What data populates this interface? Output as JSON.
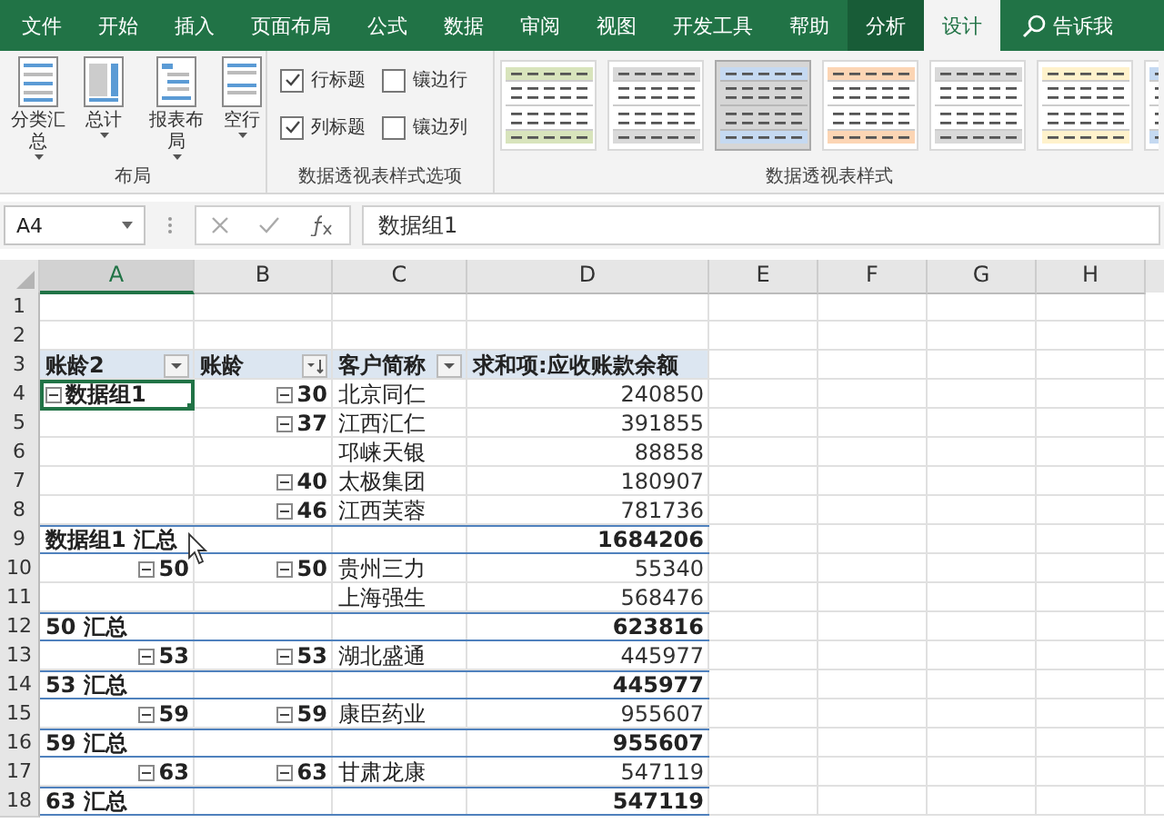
{
  "tabs": [
    {
      "label": "文件",
      "kind": "normal",
      "selected": false
    },
    {
      "label": "开始",
      "kind": "normal",
      "selected": false
    },
    {
      "label": "插入",
      "kind": "normal",
      "selected": false
    },
    {
      "label": "页面布局",
      "kind": "normal",
      "selected": false
    },
    {
      "label": "公式",
      "kind": "normal",
      "selected": false
    },
    {
      "label": "数据",
      "kind": "normal",
      "selected": false
    },
    {
      "label": "审阅",
      "kind": "normal",
      "selected": false
    },
    {
      "label": "视图",
      "kind": "normal",
      "selected": false
    },
    {
      "label": "开发工具",
      "kind": "normal",
      "selected": false
    },
    {
      "label": "帮助",
      "kind": "normal",
      "selected": false
    },
    {
      "label": "分析",
      "kind": "context",
      "selected": false
    },
    {
      "label": "设计",
      "kind": "context",
      "selected": true
    },
    {
      "label": "告诉我",
      "kind": "search",
      "selected": false
    }
  ],
  "ribbon": {
    "layout_group": {
      "label": "布局",
      "buttons": [
        {
          "label": "分类汇总"
        },
        {
          "label": "总计"
        },
        {
          "label": "报表布局"
        },
        {
          "label": "空行"
        }
      ]
    },
    "options_group": {
      "label": "数据透视表样式选项",
      "options": [
        {
          "label": "行标题",
          "checked": true
        },
        {
          "label": "镶边行",
          "checked": false
        },
        {
          "label": "列标题",
          "checked": true
        },
        {
          "label": "镶边列",
          "checked": false
        }
      ]
    },
    "styles_group": {
      "label": "数据透视表样式",
      "styles": [
        {
          "color": "#d8e4bc",
          "selected": false
        },
        {
          "color": "#d9d9d9",
          "selected": false
        },
        {
          "color": "#c5d9f1",
          "selected": true
        },
        {
          "color": "#fcd5b4",
          "selected": false
        },
        {
          "color": "#d9d9d9",
          "selected": false
        },
        {
          "color": "#fff2cc",
          "selected": false
        },
        {
          "color": "#c5d9f1",
          "selected": false
        }
      ]
    }
  },
  "formula_bar": {
    "name_box": "A4",
    "value": "数据组1"
  },
  "columns": [
    {
      "label": "A",
      "selected": true
    },
    {
      "label": "B",
      "selected": false
    },
    {
      "label": "C",
      "selected": false
    },
    {
      "label": "D",
      "selected": false
    },
    {
      "label": "E",
      "selected": false
    },
    {
      "label": "F",
      "selected": false
    },
    {
      "label": "G",
      "selected": false
    },
    {
      "label": "H",
      "selected": false
    }
  ],
  "rows": [
    {
      "num": "1",
      "kind": "blank"
    },
    {
      "num": "2",
      "kind": "blank"
    },
    {
      "num": "3",
      "kind": "header",
      "a": {
        "text": "账龄2",
        "filter": true,
        "sorted": false,
        "selected": false
      },
      "b": {
        "text": "账龄",
        "filter": true,
        "sorted": true
      },
      "c": {
        "text": "客户简称",
        "filter": true,
        "sorted": false
      },
      "d": {
        "text": "求和项:应收账款余额"
      }
    },
    {
      "num": "4",
      "kind": "item",
      "a": {
        "text": "数据组1",
        "kind": "label",
        "expander": true,
        "selected": true
      },
      "b": {
        "text": "30",
        "expander": true
      },
      "c": {
        "text": "北京同仁"
      },
      "d": {
        "text": "240850"
      }
    },
    {
      "num": "5",
      "kind": "item",
      "a": {
        "selected": false
      },
      "b": {
        "text": "37",
        "expander": true
      },
      "c": {
        "text": "江西汇仁"
      },
      "d": {
        "text": "391855"
      }
    },
    {
      "num": "6",
      "kind": "item",
      "a": {
        "selected": false
      },
      "c": {
        "text": "邛崃天银"
      },
      "d": {
        "text": "88858"
      }
    },
    {
      "num": "7",
      "kind": "item",
      "a": {
        "selected": false
      },
      "b": {
        "text": "40",
        "expander": true
      },
      "c": {
        "text": "太极集团"
      },
      "d": {
        "text": "180907"
      }
    },
    {
      "num": "8",
      "kind": "item",
      "a": {
        "selected": false
      },
      "b": {
        "text": "46",
        "expander": true
      },
      "c": {
        "text": "江西芙蓉"
      },
      "d": {
        "text": "781736"
      }
    },
    {
      "num": "9",
      "kind": "subtotal",
      "a": {
        "text": "数据组1 汇总",
        "kind": "label",
        "selected": false
      },
      "d": {
        "text": "1684206"
      }
    },
    {
      "num": "10",
      "kind": "item",
      "a": {
        "text": "50",
        "kind": "number",
        "expander": true,
        "selected": false
      },
      "b": {
        "text": "50",
        "expander": true
      },
      "c": {
        "text": "贵州三力"
      },
      "d": {
        "text": "55340"
      }
    },
    {
      "num": "11",
      "kind": "item",
      "a": {
        "selected": false
      },
      "c": {
        "text": "上海强生"
      },
      "d": {
        "text": "568476"
      }
    },
    {
      "num": "12",
      "kind": "subtotal",
      "a": {
        "text": "50 汇总",
        "kind": "label",
        "selected": false
      },
      "d": {
        "text": "623816"
      }
    },
    {
      "num": "13",
      "kind": "item",
      "a": {
        "text": "53",
        "kind": "number",
        "expander": true,
        "selected": false
      },
      "b": {
        "text": "53",
        "expander": true
      },
      "c": {
        "text": "湖北盛通"
      },
      "d": {
        "text": "445977"
      }
    },
    {
      "num": "14",
      "kind": "subtotal",
      "a": {
        "text": "53 汇总",
        "kind": "label",
        "selected": false
      },
      "d": {
        "text": "445977"
      }
    },
    {
      "num": "15",
      "kind": "item",
      "a": {
        "text": "59",
        "kind": "number",
        "expander": true,
        "selected": false
      },
      "b": {
        "text": "59",
        "expander": true
      },
      "c": {
        "text": "康臣药业"
      },
      "d": {
        "text": "955607"
      }
    },
    {
      "num": "16",
      "kind": "subtotal",
      "a": {
        "text": "59 汇总",
        "kind": "label",
        "selected": false
      },
      "d": {
        "text": "955607"
      }
    },
    {
      "num": "17",
      "kind": "item",
      "a": {
        "text": "63",
        "kind": "number",
        "expander": true,
        "selected": false
      },
      "b": {
        "text": "63",
        "expander": true
      },
      "c": {
        "text": "甘肃龙康"
      },
      "d": {
        "text": "547119"
      }
    },
    {
      "num": "18",
      "kind": "subtotal",
      "a": {
        "text": "63 汇总",
        "kind": "label",
        "selected": false
      },
      "d": {
        "text": "547119"
      }
    }
  ]
}
